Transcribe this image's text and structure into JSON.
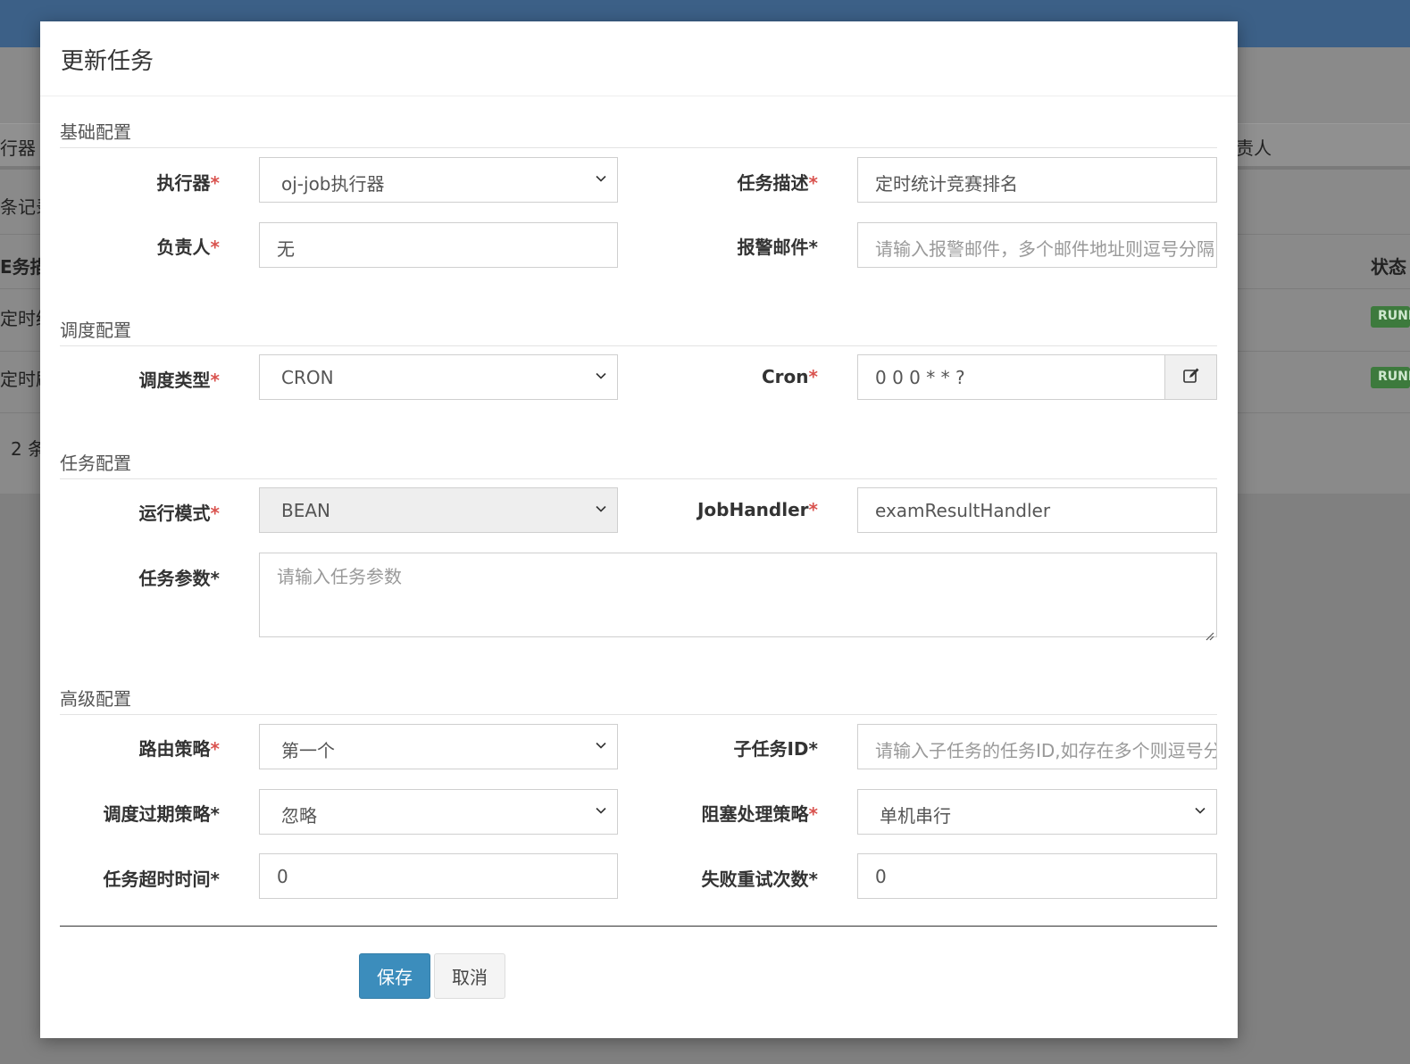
{
  "background": {
    "tab_fragment_left": "行器",
    "tab_fragment_right": "责人",
    "records_fragment": "条记录",
    "col_desc_fragment": "E务描",
    "col_status_fragment": "状态",
    "row1_fragment": "定时统",
    "row2_fragment": "定时刷",
    "row_badge": "RUNNING",
    "pager_fragment": "2 条"
  },
  "modal": {
    "title": "更新任务",
    "sections": {
      "basic": "基础配置",
      "schedule": "调度配置",
      "job": "任务配置",
      "advanced": "高级配置"
    },
    "fields": {
      "executor": {
        "label": "执行器",
        "req": "*",
        "value": "oj-job执行器"
      },
      "job_desc": {
        "label": "任务描述",
        "req": "*",
        "value": "定时统计竞赛排名"
      },
      "author": {
        "label": "负责人",
        "req": "*",
        "value": "无"
      },
      "alarm_email": {
        "label": "报警邮件*",
        "placeholder": "请输入报警邮件，多个邮件地址则逗号分隔"
      },
      "schedule_type": {
        "label": "调度类型",
        "req": "*",
        "value": "CRON"
      },
      "cron": {
        "label": "Cron",
        "req": "*",
        "value": "0 0 0 * * ?"
      },
      "glue_type": {
        "label": "运行模式",
        "req": "*",
        "value": "BEAN"
      },
      "job_handler": {
        "label": "JobHandler",
        "req": "*",
        "value": "examResultHandler"
      },
      "job_param": {
        "label": "任务参数*",
        "placeholder": "请输入任务参数"
      },
      "route_strategy": {
        "label": "路由策略",
        "req": "*",
        "value": "第一个"
      },
      "child_job_id": {
        "label": "子任务ID*",
        "placeholder": "请输入子任务的任务ID,如存在多个则逗号分隔"
      },
      "misfire_strategy": {
        "label": "调度过期策略*",
        "value": "忽略"
      },
      "block_strategy": {
        "label": "阻塞处理策略",
        "req": "*",
        "value": "单机串行"
      },
      "timeout": {
        "label": "任务超时时间*",
        "value": "0"
      },
      "fail_retry": {
        "label": "失败重试次数*",
        "value": "0"
      }
    },
    "buttons": {
      "save": "保存",
      "cancel": "取消"
    }
  },
  "colors": {
    "header_bar": "#3c6087",
    "primary_button": "#3c8dbc",
    "required_mark": "#d9534f",
    "badge": "#3d7a3d"
  }
}
